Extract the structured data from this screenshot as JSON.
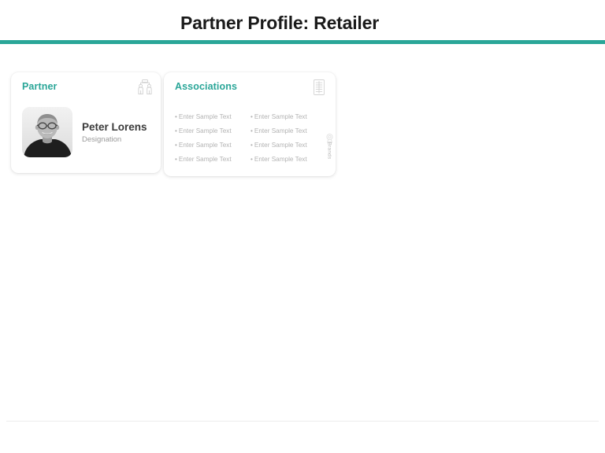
{
  "header": {
    "title": "Partner Profile: Retailer",
    "rule_color": "#2aa698"
  },
  "cards": {
    "partner": {
      "heading": "Partner",
      "heading_color": "#2aa698",
      "corner_icon": "partnership-people-icon",
      "person": {
        "avatar_icon": "person-photo",
        "name": "Peter Lorens",
        "designation": "Designation"
      }
    },
    "associations": {
      "heading": "Associations",
      "heading_color": "#2aa698",
      "corner_icon": "list-document-icon",
      "bullet": "•",
      "columns": [
        {
          "items": [
            "Enter Sample Text",
            "Enter Sample Text",
            "Enter Sample Text",
            "Enter Sample Text"
          ]
        },
        {
          "items": [
            "Enter Sample Text",
            "Enter Sample Text",
            "Enter Sample Text",
            "Enter Sample Text"
          ]
        }
      ]
    }
  },
  "side_tab": {
    "icon": "badge-icon",
    "label": "Brands"
  }
}
